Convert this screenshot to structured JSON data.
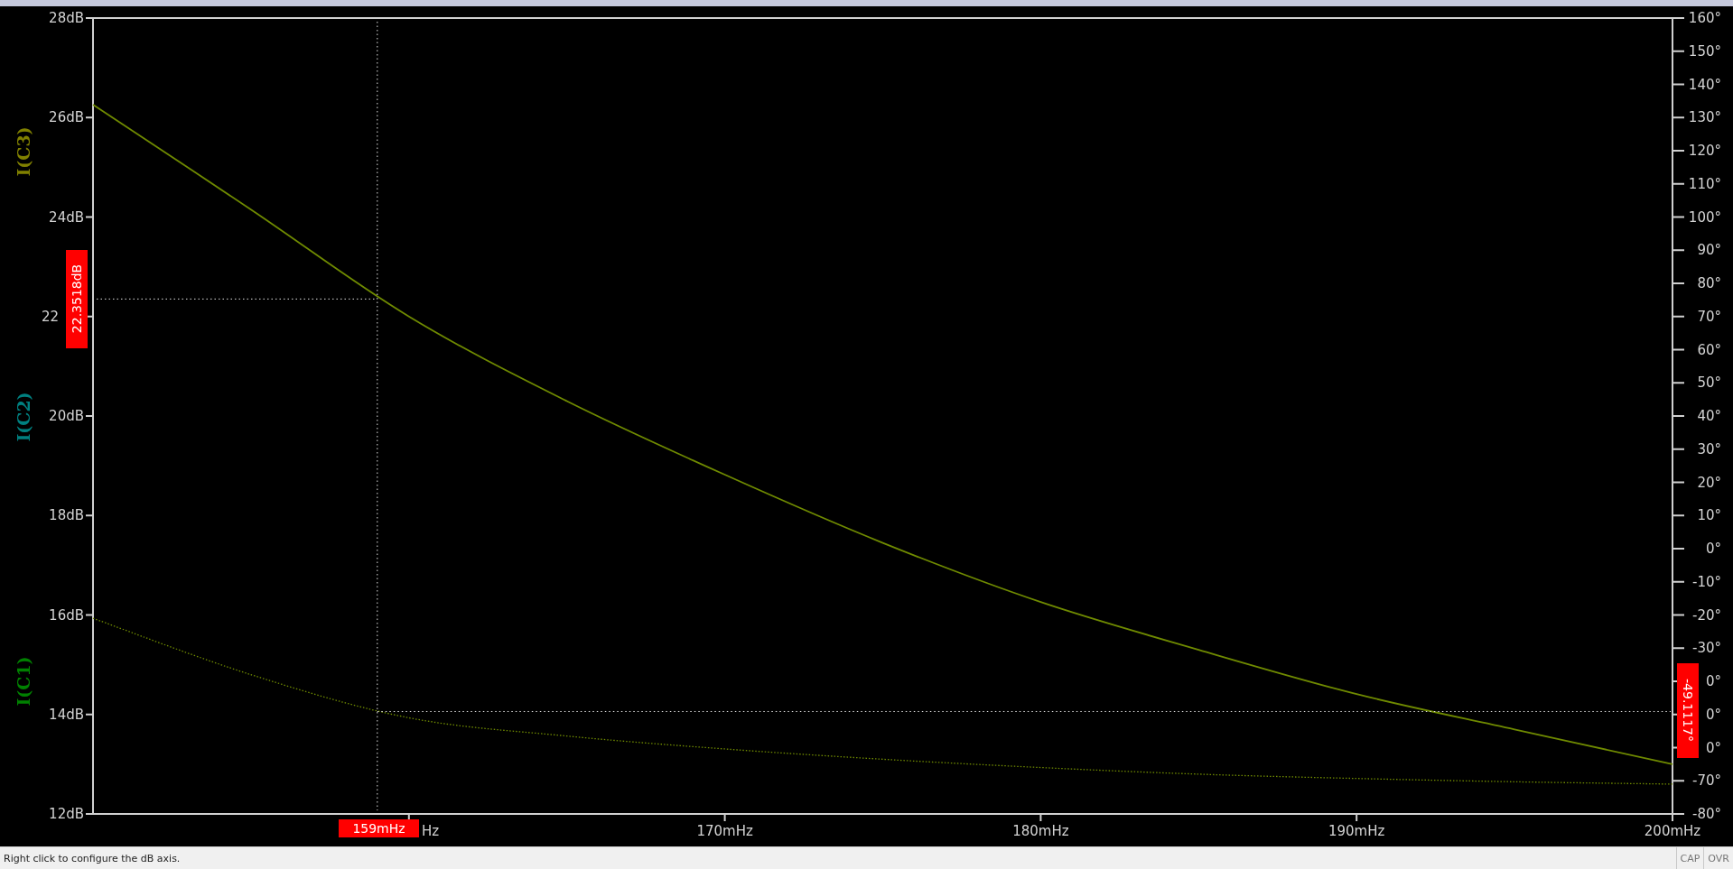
{
  "plot": {
    "trace_labels": [
      {
        "text": "I(C3)",
        "color": "#808000"
      },
      {
        "text": "I(C2)",
        "color": "#008080"
      },
      {
        "text": "I(C1)",
        "color": "#008000"
      }
    ],
    "chart_data": {
      "type": "line",
      "x": [
        150,
        155,
        160,
        165,
        170,
        175,
        180,
        185,
        190,
        195,
        200
      ],
      "xlim": [
        150,
        200
      ],
      "ylim": [
        12,
        28
      ],
      "y2lim": [
        -80,
        160
      ],
      "xticks": [
        {
          "value": 170,
          "label": "170mHz"
        },
        {
          "value": 180,
          "label": "180mHz"
        },
        {
          "value": 190,
          "label": "190mHz"
        },
        {
          "value": 200,
          "label": "200mHz"
        }
      ],
      "yticks": [
        {
          "value": 28,
          "label": "28dB"
        },
        {
          "value": 26,
          "label": "26dB"
        },
        {
          "value": 24,
          "label": "24dB"
        },
        {
          "value": 20,
          "label": "20dB"
        },
        {
          "value": 18,
          "label": "18dB"
        },
        {
          "value": 16,
          "label": "16dB"
        },
        {
          "value": 14,
          "label": "14dB"
        },
        {
          "value": 12,
          "label": "12dB"
        }
      ],
      "y2ticks": [
        {
          "value": 160,
          "label": "160°"
        },
        {
          "value": 150,
          "label": "150°"
        },
        {
          "value": 140,
          "label": "140°"
        },
        {
          "value": 130,
          "label": "130°"
        },
        {
          "value": 120,
          "label": "120°"
        },
        {
          "value": 110,
          "label": "110°"
        },
        {
          "value": 100,
          "label": "100°"
        },
        {
          "value": 90,
          "label": "90°"
        },
        {
          "value": 80,
          "label": "80°"
        },
        {
          "value": 70,
          "label": "70°"
        },
        {
          "value": 60,
          "label": "60°"
        },
        {
          "value": 50,
          "label": "50°"
        },
        {
          "value": 40,
          "label": "40°"
        },
        {
          "value": 30,
          "label": "30°"
        },
        {
          "value": 20,
          "label": "20°"
        },
        {
          "value": 10,
          "label": "10°"
        },
        {
          "value": 0,
          "label": "0°"
        },
        {
          "value": -10,
          "label": "-10°"
        },
        {
          "value": -20,
          "label": "-20°"
        },
        {
          "value": -30,
          "label": "-30°"
        },
        {
          "value": -70,
          "label": "-70°"
        },
        {
          "value": -80,
          "label": "-80°"
        }
      ],
      "series": [
        {
          "color": "#6f8a00",
          "values": [
            26.26,
            24.15,
            22.0,
            20.3,
            18.82,
            17.45,
            16.26,
            15.3,
            14.41,
            13.7,
            13.0
          ]
        },
        {
          "color": "#6f8a00",
          "axis": "y2",
          "line_style": "dotted",
          "values": [
            -21,
            -38,
            -51,
            -56.5,
            -60.4,
            -63.5,
            -66,
            -68,
            -69.3,
            -70.3,
            -71
          ]
        }
      ]
    },
    "partial_tick_labels": [
      {
        "text": "22"
      },
      {
        "text": "Hz"
      },
      {
        "text": "0°"
      },
      {
        "text": "0°"
      },
      {
        "text": "0°"
      }
    ],
    "cursor": {
      "x_readout": "159mHz",
      "y_readout": "22.3518dB",
      "y2_readout": "-49.1117°"
    }
  },
  "status_bar": {
    "message": "Right click to configure the dB axis.",
    "indicators": [
      "CAP",
      "OVR"
    ]
  }
}
